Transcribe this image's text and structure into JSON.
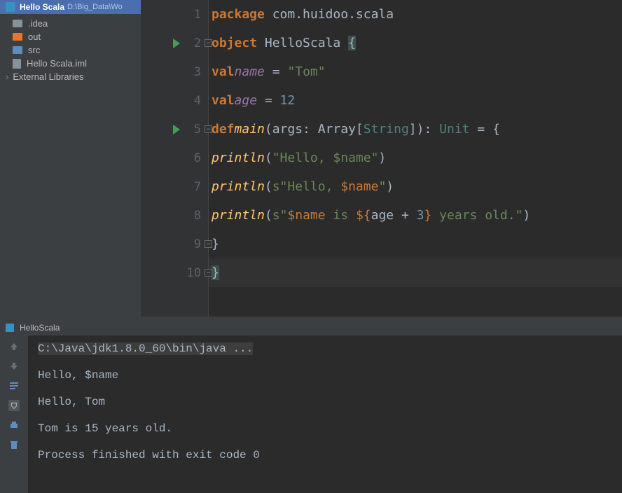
{
  "project": {
    "name": "Hello Scala",
    "path": "D:\\Big_Data\\Wo"
  },
  "tree": [
    {
      "icon": "folder-grey",
      "label": ".idea"
    },
    {
      "icon": "folder-orange",
      "label": "out"
    },
    {
      "icon": "folder-blue",
      "label": "src"
    },
    {
      "icon": "file",
      "label": "Hello Scala.iml"
    }
  ],
  "external": "External Libraries",
  "code": {
    "lines": [
      {
        "n": "1"
      },
      {
        "n": "2"
      },
      {
        "n": "3"
      },
      {
        "n": "4"
      },
      {
        "n": "5"
      },
      {
        "n": "6"
      },
      {
        "n": "7"
      },
      {
        "n": "8"
      },
      {
        "n": "9"
      },
      {
        "n": "10"
      }
    ],
    "tokens": {
      "package": "package",
      "pkgname": " com.huidoo.scala",
      "object": "object",
      "classname": " HelloScala ",
      "lbrace": "{",
      "val": "val",
      "name_ident": "name",
      "eq": " = ",
      "tom_str": "\"Tom\"",
      "age_ident": "age",
      "twelve": "12",
      "def": "def",
      "main": "main",
      "args_open": "(args: ",
      "array": "Array",
      "string_open": "[",
      "string": "String",
      "string_close": "]):",
      "unit": " Unit ",
      "eq2": "= {",
      "println": "println",
      "hello1_open": "(",
      "hello1_str": "\"Hello, $name\"",
      "hello1_close": ")",
      "hello2_s": "s",
      "hello2_str1": "\"Hello, ",
      "hello2_var": "$name",
      "hello2_str2": "\"",
      "line8_s": "s",
      "line8_q1": "\"",
      "line8_var1": "$name",
      "line8_is": " is ",
      "line8_exp": "${",
      "line8_age": "age",
      "line8_plus": " + ",
      "line8_three": "3",
      "line8_exp_close": "}",
      "line8_years": " years old.",
      "line8_q2": "\"",
      "rbrace": "}",
      "rbrace2": "}"
    }
  },
  "run": {
    "title": "HelloScala",
    "output": [
      "C:\\Java\\jdk1.8.0_60\\bin\\java ...",
      "Hello, $name",
      "Hello, Tom",
      "Tom is 15 years old.",
      "",
      "Process finished with exit code 0"
    ]
  }
}
